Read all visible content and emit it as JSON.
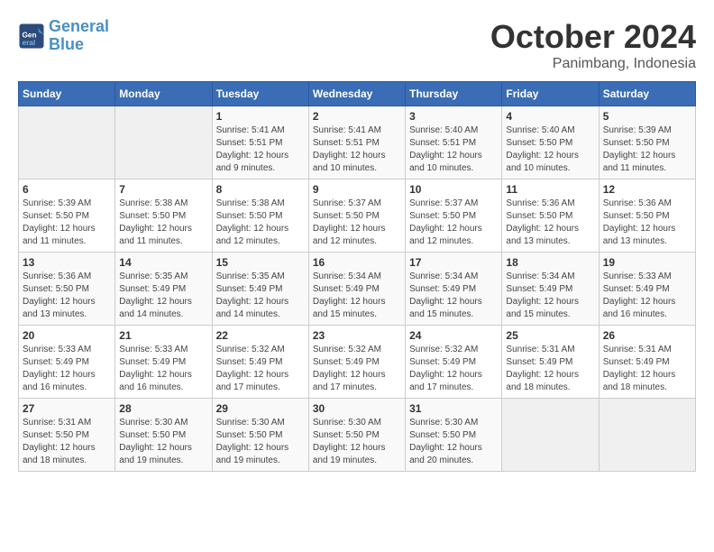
{
  "header": {
    "logo_line1": "General",
    "logo_line2": "Blue",
    "month": "October 2024",
    "location": "Panimbang, Indonesia"
  },
  "weekdays": [
    "Sunday",
    "Monday",
    "Tuesday",
    "Wednesday",
    "Thursday",
    "Friday",
    "Saturday"
  ],
  "weeks": [
    [
      {
        "day": "",
        "info": ""
      },
      {
        "day": "",
        "info": ""
      },
      {
        "day": "1",
        "info": "Sunrise: 5:41 AM\nSunset: 5:51 PM\nDaylight: 12 hours and 9 minutes."
      },
      {
        "day": "2",
        "info": "Sunrise: 5:41 AM\nSunset: 5:51 PM\nDaylight: 12 hours and 10 minutes."
      },
      {
        "day": "3",
        "info": "Sunrise: 5:40 AM\nSunset: 5:51 PM\nDaylight: 12 hours and 10 minutes."
      },
      {
        "day": "4",
        "info": "Sunrise: 5:40 AM\nSunset: 5:50 PM\nDaylight: 12 hours and 10 minutes."
      },
      {
        "day": "5",
        "info": "Sunrise: 5:39 AM\nSunset: 5:50 PM\nDaylight: 12 hours and 11 minutes."
      }
    ],
    [
      {
        "day": "6",
        "info": "Sunrise: 5:39 AM\nSunset: 5:50 PM\nDaylight: 12 hours and 11 minutes."
      },
      {
        "day": "7",
        "info": "Sunrise: 5:38 AM\nSunset: 5:50 PM\nDaylight: 12 hours and 11 minutes."
      },
      {
        "day": "8",
        "info": "Sunrise: 5:38 AM\nSunset: 5:50 PM\nDaylight: 12 hours and 12 minutes."
      },
      {
        "day": "9",
        "info": "Sunrise: 5:37 AM\nSunset: 5:50 PM\nDaylight: 12 hours and 12 minutes."
      },
      {
        "day": "10",
        "info": "Sunrise: 5:37 AM\nSunset: 5:50 PM\nDaylight: 12 hours and 12 minutes."
      },
      {
        "day": "11",
        "info": "Sunrise: 5:36 AM\nSunset: 5:50 PM\nDaylight: 12 hours and 13 minutes."
      },
      {
        "day": "12",
        "info": "Sunrise: 5:36 AM\nSunset: 5:50 PM\nDaylight: 12 hours and 13 minutes."
      }
    ],
    [
      {
        "day": "13",
        "info": "Sunrise: 5:36 AM\nSunset: 5:50 PM\nDaylight: 12 hours and 13 minutes."
      },
      {
        "day": "14",
        "info": "Sunrise: 5:35 AM\nSunset: 5:49 PM\nDaylight: 12 hours and 14 minutes."
      },
      {
        "day": "15",
        "info": "Sunrise: 5:35 AM\nSunset: 5:49 PM\nDaylight: 12 hours and 14 minutes."
      },
      {
        "day": "16",
        "info": "Sunrise: 5:34 AM\nSunset: 5:49 PM\nDaylight: 12 hours and 15 minutes."
      },
      {
        "day": "17",
        "info": "Sunrise: 5:34 AM\nSunset: 5:49 PM\nDaylight: 12 hours and 15 minutes."
      },
      {
        "day": "18",
        "info": "Sunrise: 5:34 AM\nSunset: 5:49 PM\nDaylight: 12 hours and 15 minutes."
      },
      {
        "day": "19",
        "info": "Sunrise: 5:33 AM\nSunset: 5:49 PM\nDaylight: 12 hours and 16 minutes."
      }
    ],
    [
      {
        "day": "20",
        "info": "Sunrise: 5:33 AM\nSunset: 5:49 PM\nDaylight: 12 hours and 16 minutes."
      },
      {
        "day": "21",
        "info": "Sunrise: 5:33 AM\nSunset: 5:49 PM\nDaylight: 12 hours and 16 minutes."
      },
      {
        "day": "22",
        "info": "Sunrise: 5:32 AM\nSunset: 5:49 PM\nDaylight: 12 hours and 17 minutes."
      },
      {
        "day": "23",
        "info": "Sunrise: 5:32 AM\nSunset: 5:49 PM\nDaylight: 12 hours and 17 minutes."
      },
      {
        "day": "24",
        "info": "Sunrise: 5:32 AM\nSunset: 5:49 PM\nDaylight: 12 hours and 17 minutes."
      },
      {
        "day": "25",
        "info": "Sunrise: 5:31 AM\nSunset: 5:49 PM\nDaylight: 12 hours and 18 minutes."
      },
      {
        "day": "26",
        "info": "Sunrise: 5:31 AM\nSunset: 5:49 PM\nDaylight: 12 hours and 18 minutes."
      }
    ],
    [
      {
        "day": "27",
        "info": "Sunrise: 5:31 AM\nSunset: 5:50 PM\nDaylight: 12 hours and 18 minutes."
      },
      {
        "day": "28",
        "info": "Sunrise: 5:30 AM\nSunset: 5:50 PM\nDaylight: 12 hours and 19 minutes."
      },
      {
        "day": "29",
        "info": "Sunrise: 5:30 AM\nSunset: 5:50 PM\nDaylight: 12 hours and 19 minutes."
      },
      {
        "day": "30",
        "info": "Sunrise: 5:30 AM\nSunset: 5:50 PM\nDaylight: 12 hours and 19 minutes."
      },
      {
        "day": "31",
        "info": "Sunrise: 5:30 AM\nSunset: 5:50 PM\nDaylight: 12 hours and 20 minutes."
      },
      {
        "day": "",
        "info": ""
      },
      {
        "day": "",
        "info": ""
      }
    ]
  ]
}
